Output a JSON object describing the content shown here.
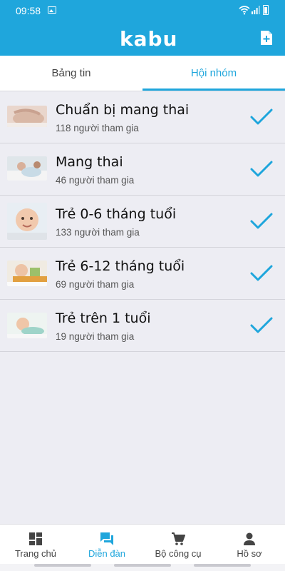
{
  "status_bar": {
    "time": "09:58"
  },
  "app": {
    "logo": "kabu"
  },
  "tabs": [
    {
      "label": "Bảng tin",
      "active": false
    },
    {
      "label": "Hội nhóm",
      "active": true
    }
  ],
  "groups": [
    {
      "title": "Chuẩn bị mang thai",
      "members": "118 người tham gia",
      "joined": true
    },
    {
      "title": "Mang thai",
      "members": "46 người tham gia",
      "joined": true
    },
    {
      "title": "Trẻ 0-6 tháng tuổi",
      "members": "133 người tham gia",
      "joined": true
    },
    {
      "title": "Trẻ 6-12 tháng tuổi",
      "members": "69 người tham gia",
      "joined": true
    },
    {
      "title": "Trẻ trên 1 tuổi",
      "members": "19 người tham gia",
      "joined": true
    }
  ],
  "bottom_nav": [
    {
      "label": "Trang chủ",
      "icon": "dashboard-icon",
      "active": false
    },
    {
      "label": "Diễn đàn",
      "icon": "forum-icon",
      "active": true
    },
    {
      "label": "Bộ công cụ",
      "icon": "cart-icon",
      "active": false
    },
    {
      "label": "Hồ sơ",
      "icon": "person-icon",
      "active": false
    }
  ],
  "colors": {
    "accent": "#1fa6dc",
    "background": "#ededf3",
    "check": "#1fa6dc"
  }
}
